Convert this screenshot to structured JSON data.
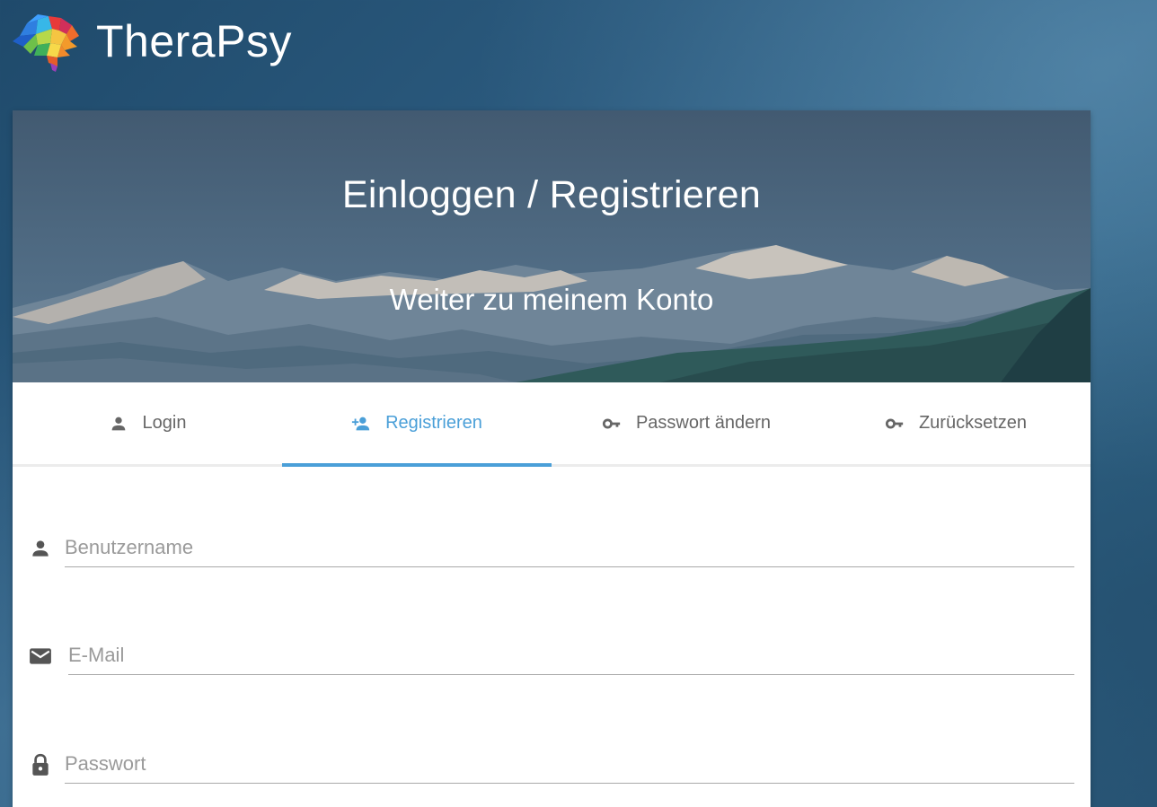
{
  "brand": {
    "name": "TheraPsy"
  },
  "hero": {
    "title": "Einloggen / Registrieren",
    "subtitle": "Weiter zu meinem Konto"
  },
  "tabs": [
    {
      "label": "Login",
      "icon": "person-icon",
      "active": false
    },
    {
      "label": "Registrieren",
      "icon": "person-add-icon",
      "active": true
    },
    {
      "label": "Passwort ändern",
      "icon": "key-icon",
      "active": false
    },
    {
      "label": "Zurücksetzen",
      "icon": "key-icon",
      "active": false
    }
  ],
  "form": {
    "username": {
      "placeholder": "Benutzername",
      "value": "",
      "icon": "person-icon"
    },
    "email": {
      "placeholder": "E-Mail",
      "value": "",
      "icon": "email-icon"
    },
    "password": {
      "placeholder": "Passwort",
      "value": "",
      "icon": "lock-icon"
    }
  },
  "colors": {
    "accent": "#4a9fd8",
    "tab_text": "#666666",
    "icon": "#555555",
    "placeholder": "#9a9a9a"
  }
}
